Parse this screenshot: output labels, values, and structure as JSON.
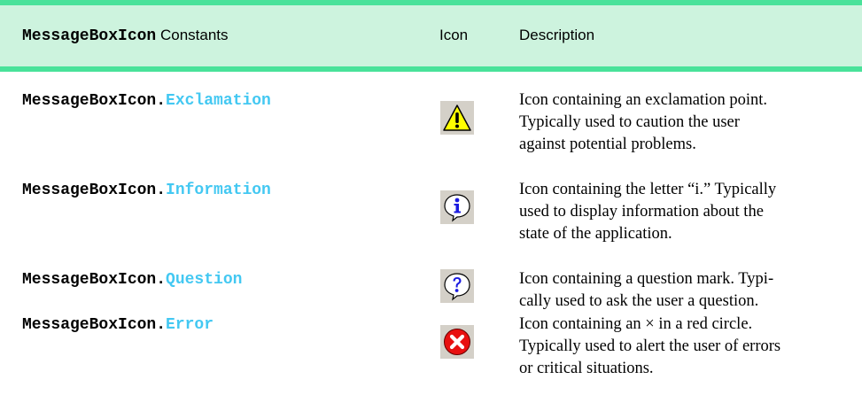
{
  "header": {
    "col1_code": "MessageBoxIcon",
    "col1_suffix": " Constants",
    "col2": "Icon",
    "col3": "Description"
  },
  "rows": [
    {
      "prefix": "MessageBoxIcon.",
      "member": "Exclamation",
      "icon": "exclamation-icon",
      "desc_lines": [
        "Icon containing an exclamation point.",
        "Typically used to caution the user",
        "against potential problems."
      ]
    },
    {
      "prefix": "MessageBoxIcon.",
      "member": "Information",
      "icon": "information-icon",
      "desc_lines": [
        "Icon containing the letter “i.” Typically",
        "used to display information about the",
        "state of the application."
      ]
    },
    {
      "prefix": "MessageBoxIcon.",
      "member": "Question",
      "icon": "question-icon",
      "desc_lines": [
        "Icon containing a question mark. Typi-",
        "cally used to ask the user a question."
      ]
    },
    {
      "prefix": "MessageBoxIcon.",
      "member": "Error",
      "icon": "error-icon",
      "desc_lines": [
        "Icon containing an × in a red circle.",
        "Typically used to alert the user of errors",
        "or critical situations."
      ]
    }
  ],
  "colors": {
    "header_rule": "#49e29a",
    "header_fill": "#cdf3de",
    "member_color": "#43c8f2"
  }
}
